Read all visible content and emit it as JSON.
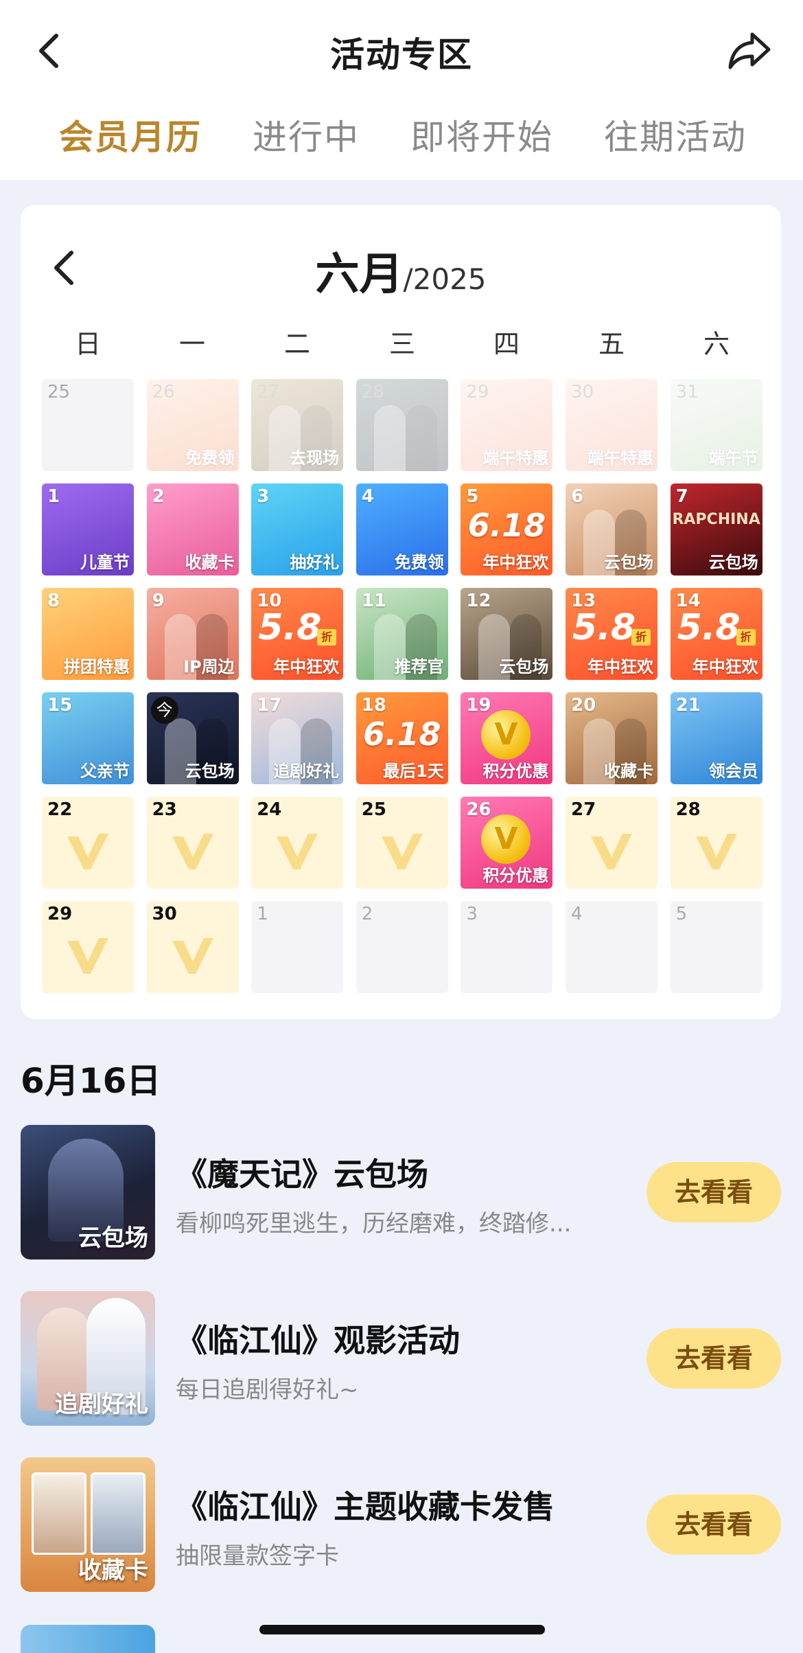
{
  "header": {
    "title": "活动专区",
    "back_icon": "back-arrow-icon",
    "share_icon": "share-icon"
  },
  "tabs": [
    {
      "label": "会员月历",
      "active": true
    },
    {
      "label": "进行中",
      "active": false
    },
    {
      "label": "即将开始",
      "active": false
    },
    {
      "label": "往期活动",
      "active": false
    }
  ],
  "calendar": {
    "month": "六月",
    "year": "/2025",
    "weekdays": [
      "日",
      "一",
      "二",
      "三",
      "四",
      "五",
      "六"
    ],
    "days": [
      {
        "num": "25",
        "label": "",
        "style": "empty",
        "faded": true
      },
      {
        "num": "26",
        "label": "免费领",
        "style": "crown",
        "faded": true
      },
      {
        "num": "27",
        "label": "去现场",
        "style": "warriors",
        "faded": true
      },
      {
        "num": "28",
        "label": "",
        "style": "soldiers",
        "faded": true
      },
      {
        "num": "29",
        "label": "端午特惠",
        "style": "zongzi",
        "faded": true
      },
      {
        "num": "30",
        "label": "端午特惠",
        "style": "zongzi",
        "faded": true
      },
      {
        "num": "31",
        "label": "端午节",
        "style": "mountain",
        "faded": true
      },
      {
        "num": "1",
        "label": "儿童节",
        "style": "kids"
      },
      {
        "num": "2",
        "label": "收藏卡",
        "style": "pinkcard"
      },
      {
        "num": "3",
        "label": "抽好礼",
        "style": "giftbox"
      },
      {
        "num": "4",
        "label": "免费领",
        "style": "crownblue"
      },
      {
        "num": "5",
        "label": "年中狂欢",
        "style": "sale618",
        "big": "6.18"
      },
      {
        "num": "6",
        "label": "云包场",
        "style": "drama"
      },
      {
        "num": "7",
        "label": "云包场",
        "style": "rap",
        "big": "RAPCHINA"
      },
      {
        "num": "8",
        "label": "拼团特惠",
        "style": "puzzle"
      },
      {
        "num": "9",
        "label": "IP周边",
        "style": "couple"
      },
      {
        "num": "10",
        "label": "年中狂欢",
        "style": "sale58",
        "big": "5.8",
        "zhe": "折"
      },
      {
        "num": "11",
        "label": "推荐官",
        "style": "couplegreen"
      },
      {
        "num": "12",
        "label": "云包场",
        "style": "actor"
      },
      {
        "num": "13",
        "label": "年中狂欢",
        "style": "sale58",
        "big": "5.8",
        "zhe": "折"
      },
      {
        "num": "14",
        "label": "年中狂欢",
        "style": "sale58",
        "big": "5.8",
        "zhe": "折"
      },
      {
        "num": "15",
        "label": "父亲节",
        "style": "father"
      },
      {
        "num": "今",
        "label": "云包场",
        "style": "today"
      },
      {
        "num": "17",
        "label": "追剧好礼",
        "style": "lover"
      },
      {
        "num": "18",
        "label": "最后1天",
        "style": "sale618",
        "big": "6.18"
      },
      {
        "num": "19",
        "label": "积分优惠",
        "style": "coin",
        "coin": "V"
      },
      {
        "num": "20",
        "label": "收藏卡",
        "style": "cardbrown"
      },
      {
        "num": "21",
        "label": "领会员",
        "style": "vipcard"
      },
      {
        "num": "22",
        "label": "",
        "style": "vip"
      },
      {
        "num": "23",
        "label": "",
        "style": "vip"
      },
      {
        "num": "24",
        "label": "",
        "style": "vip"
      },
      {
        "num": "25",
        "label": "",
        "style": "vip"
      },
      {
        "num": "26",
        "label": "积分优惠",
        "style": "coin",
        "coin": "V"
      },
      {
        "num": "27",
        "label": "",
        "style": "vip"
      },
      {
        "num": "28",
        "label": "",
        "style": "vip"
      },
      {
        "num": "29",
        "label": "",
        "style": "vip"
      },
      {
        "num": "30",
        "label": "",
        "style": "vip"
      },
      {
        "num": "1",
        "label": "",
        "style": "empty",
        "faded": true
      },
      {
        "num": "2",
        "label": "",
        "style": "empty",
        "faded": true
      },
      {
        "num": "3",
        "label": "",
        "style": "empty",
        "faded": true
      },
      {
        "num": "4",
        "label": "",
        "style": "empty",
        "faded": true
      },
      {
        "num": "5",
        "label": "",
        "style": "empty",
        "faded": true
      }
    ]
  },
  "list": {
    "date": "6月16日",
    "items": [
      {
        "thumb_label": "云包场",
        "title": "《魔天记》云包场",
        "desc": "看柳鸣死里逃生，历经磨难，终踏修...",
        "button": "去看看",
        "thumb_style": "dark"
      },
      {
        "thumb_label": "追剧好礼",
        "title": "《临江仙》观影活动",
        "desc": "每日追剧得好礼~",
        "button": "去看看",
        "thumb_style": "pink"
      },
      {
        "thumb_label": "收藏卡",
        "title": "《临江仙》主题收藏卡发售",
        "desc": "抽限量款签字卡",
        "button": "去看看",
        "thumb_style": "gold"
      }
    ]
  },
  "colors": {
    "accent": "#b9862b",
    "button_bg": "#fde28a",
    "page_bg": "#eef1fa"
  }
}
